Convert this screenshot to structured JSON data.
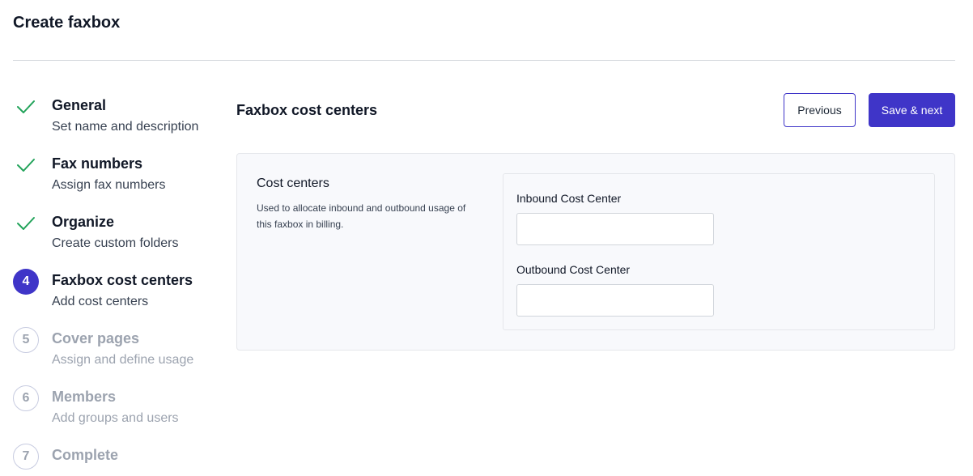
{
  "page": {
    "title": "Create faxbox"
  },
  "stepper": {
    "steps": [
      {
        "marker": "",
        "title": "General",
        "subtitle": "Set name and description",
        "state": "done"
      },
      {
        "marker": "",
        "title": "Fax numbers",
        "subtitle": "Assign fax numbers",
        "state": "done"
      },
      {
        "marker": "",
        "title": "Organize",
        "subtitle": "Create custom folders",
        "state": "done"
      },
      {
        "marker": "4",
        "title": "Faxbox cost centers",
        "subtitle": "Add cost centers",
        "state": "active"
      },
      {
        "marker": "5",
        "title": "Cover pages",
        "subtitle": "Assign and define usage",
        "state": "pending"
      },
      {
        "marker": "6",
        "title": "Members",
        "subtitle": "Add groups and users",
        "state": "pending"
      },
      {
        "marker": "7",
        "title": "Complete",
        "subtitle": "",
        "state": "pending"
      }
    ],
    "check_icon": "checkmark-icon"
  },
  "section": {
    "title": "Faxbox cost centers",
    "previous_label": "Previous",
    "save_next_label": "Save & next"
  },
  "card": {
    "heading": "Cost centers",
    "description": "Used to allocate inbound and outbound usage of this faxbox in billing.",
    "inbound": {
      "label": "Inbound Cost Center",
      "value": "",
      "placeholder": ""
    },
    "outbound": {
      "label": "Outbound Cost Center",
      "value": "",
      "placeholder": ""
    }
  },
  "colors": {
    "accent": "#3f35c8",
    "check": "#22a35a",
    "pending": "#9ca3af"
  }
}
